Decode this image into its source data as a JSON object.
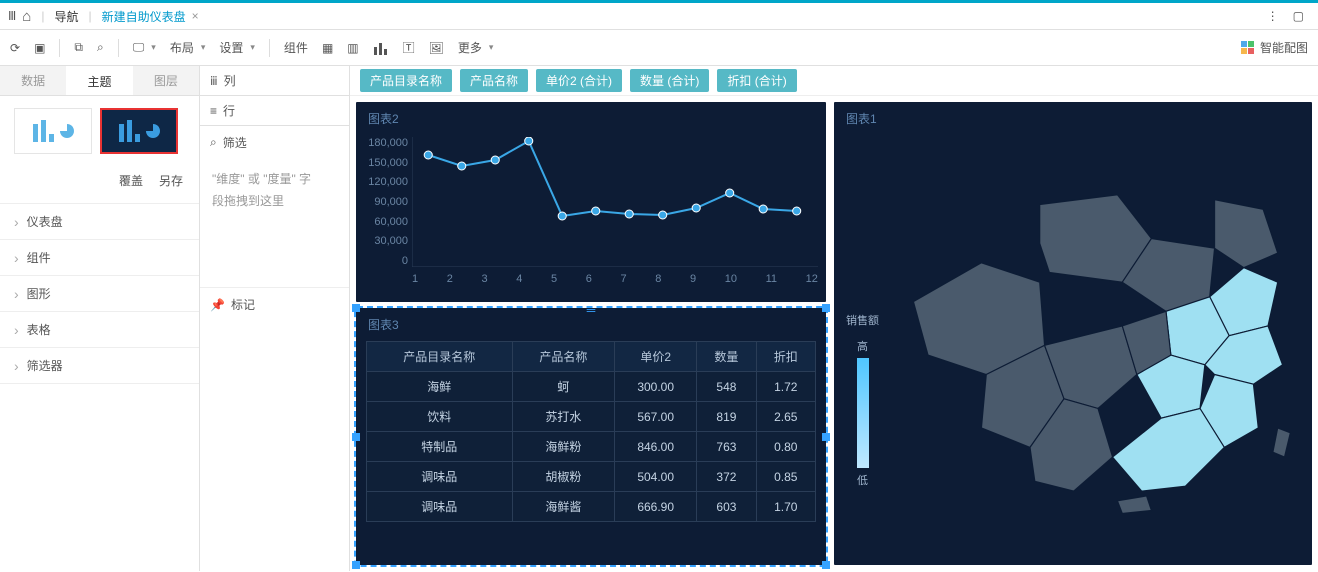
{
  "breadcrumb": {
    "nav": "导航",
    "current": "新建自助仪表盘"
  },
  "toolbar": {
    "layout": "布局",
    "settings": "设置",
    "component": "组件",
    "more": "更多",
    "smart": "智能配图"
  },
  "leftPanel": {
    "tabs": {
      "data": "数据",
      "theme": "主题",
      "layer": "图层"
    },
    "actions": {
      "overwrite": "覆盖",
      "saveAs": "另存"
    },
    "accordion": {
      "dashboard": "仪表盘",
      "component": "组件",
      "shape": "图形",
      "table": "表格",
      "filter": "筛选器"
    }
  },
  "midPanel": {
    "cols": "列",
    "rows": "行",
    "filter": "筛选",
    "dropHint1": "\"维度\"  或  \"度量\"  字",
    "dropHint2": "段拖拽到这里",
    "mark": "标记"
  },
  "pills": [
    "产品目录名称",
    "产品名称",
    "单价2 (合计)",
    "数量 (合计)",
    "折扣 (合计)"
  ],
  "chart2": {
    "title": "图表2",
    "yticks": [
      "180,000",
      "150,000",
      "120,000",
      "90,000",
      "60,000",
      "30,000",
      "0"
    ],
    "xticks": [
      "1",
      "2",
      "3",
      "4",
      "5",
      "6",
      "7",
      "8",
      "9",
      "10",
      "11",
      "12"
    ]
  },
  "chart3": {
    "title": "图表3",
    "headers": [
      "产品目录名称",
      "产品名称",
      "单价2",
      "数量",
      "折扣"
    ],
    "rows": [
      [
        "海鲜",
        "蚵",
        "300.00",
        "548",
        "1.72"
      ],
      [
        "饮料",
        "苏打水",
        "567.00",
        "819",
        "2.65"
      ],
      [
        "特制品",
        "海鲜粉",
        "846.00",
        "763",
        "0.80"
      ],
      [
        "调味品",
        "胡椒粉",
        "504.00",
        "372",
        "0.85"
      ],
      [
        "调味品",
        "海鲜酱",
        "666.90",
        "603",
        "1.70"
      ]
    ]
  },
  "chart1": {
    "title": "图表1",
    "legendTitle": "销售额",
    "hi": "高",
    "lo": "低"
  },
  "chart_data": [
    {
      "type": "line",
      "title": "图表2",
      "x": [
        1,
        2,
        3,
        4,
        5,
        6,
        7,
        8,
        9,
        10,
        11,
        12
      ],
      "values": [
        155000,
        140000,
        148000,
        175000,
        70000,
        78000,
        74000,
        72000,
        82000,
        103000,
        80000,
        78000
      ],
      "ylim": [
        0,
        180000
      ]
    },
    {
      "type": "table",
      "title": "图表3",
      "columns": [
        "产品目录名称",
        "产品名称",
        "单价2",
        "数量",
        "折扣"
      ],
      "rows": [
        [
          "海鲜",
          "蚵",
          300.0,
          548,
          1.72
        ],
        [
          "饮料",
          "苏打水",
          567.0,
          819,
          2.65
        ],
        [
          "特制品",
          "海鲜粉",
          846.0,
          763,
          0.8
        ],
        [
          "调味品",
          "胡椒粉",
          504.0,
          372,
          0.85
        ],
        [
          "调味品",
          "海鲜酱",
          666.9,
          603,
          1.7
        ]
      ]
    },
    {
      "type": "heatmap",
      "title": "图表1 (map)",
      "metric": "销售额",
      "scale": [
        "低",
        "高"
      ]
    }
  ]
}
